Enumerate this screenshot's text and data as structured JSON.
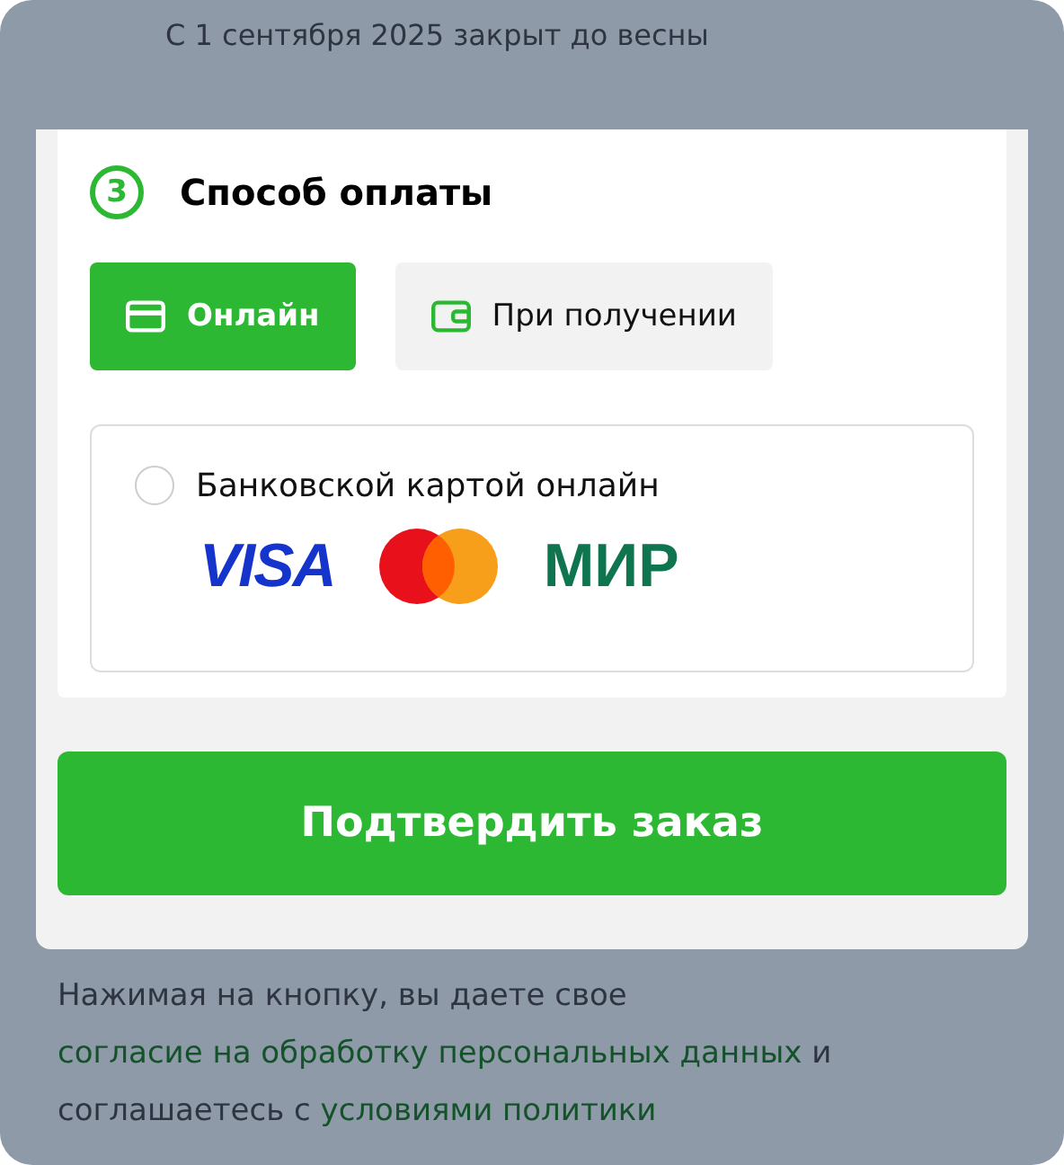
{
  "background_notice": "С 1 сентября 2025 закрыт до весны",
  "step": {
    "number": "3",
    "title": "Способ оплаты"
  },
  "payment_types": [
    {
      "label": "Онлайн",
      "kind": "card",
      "selected": true
    },
    {
      "label": "При получении",
      "kind": "wallet",
      "selected": false
    }
  ],
  "options": [
    {
      "label": "Банковской картой онлайн",
      "checked": false,
      "logos": [
        {
          "kind": "visa",
          "text": "VISA"
        },
        {
          "kind": "circles"
        },
        {
          "kind": "mir",
          "text": "МИР"
        }
      ]
    }
  ],
  "confirm_button": "Подтвердить заказ",
  "consent": [
    {
      "text": "Нажимая на кнопку, вы даете свое ",
      "link": false
    },
    {
      "text": "согласие на обработку персональных данных",
      "link": true
    },
    {
      "text": " и соглашаетесь с ",
      "link": false
    },
    {
      "text": "условиями политики",
      "link": true
    }
  ]
}
